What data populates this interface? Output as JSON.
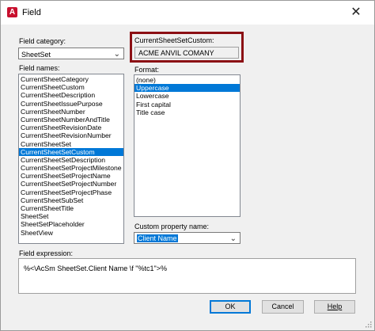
{
  "window": {
    "title": "Field",
    "close_glyph": "✕",
    "app_icon": "A"
  },
  "field_category": {
    "label": "Field category:",
    "value": "SheetSet"
  },
  "field_names": {
    "label": "Field names:",
    "items": [
      "CurrentSheetCategory",
      "CurrentSheetCustom",
      "CurrentSheetDescription",
      "CurrentSheetIssuePurpose",
      "CurrentSheetNumber",
      "CurrentSheetNumberAndTitle",
      "CurrentSheetRevisionDate",
      "CurrentSheetRevisionNumber",
      "CurrentSheetSet",
      "CurrentSheetSetCustom",
      "CurrentSheetSetDescription",
      "CurrentSheetSetProjectMilestone",
      "CurrentSheetSetProjectName",
      "CurrentSheetSetProjectNumber",
      "CurrentSheetSetProjectPhase",
      "CurrentSheetSubSet",
      "CurrentSheetTitle",
      "SheetSet",
      "SheetSetPlaceholder",
      "SheetView"
    ],
    "selected": "CurrentSheetSetCustom"
  },
  "preview": {
    "label": "CurrentSheetSetCustom:",
    "value": "ACME ANVIL COMANY"
  },
  "format": {
    "label": "Format:",
    "items": [
      "(none)",
      "Uppercase",
      "Lowercase",
      "First capital",
      "Title case"
    ],
    "selected": "Uppercase"
  },
  "custom_property": {
    "label": "Custom property name:",
    "value": "Client Name"
  },
  "field_expression": {
    "label": "Field expression:",
    "value": "%<\\AcSm SheetSet.Client Name \\f \"%tc1\">%"
  },
  "buttons": {
    "ok": "OK",
    "cancel": "Cancel",
    "help": "Help"
  },
  "colors": {
    "selection": "#0078d7",
    "highlight_border": "#8b0f14"
  }
}
